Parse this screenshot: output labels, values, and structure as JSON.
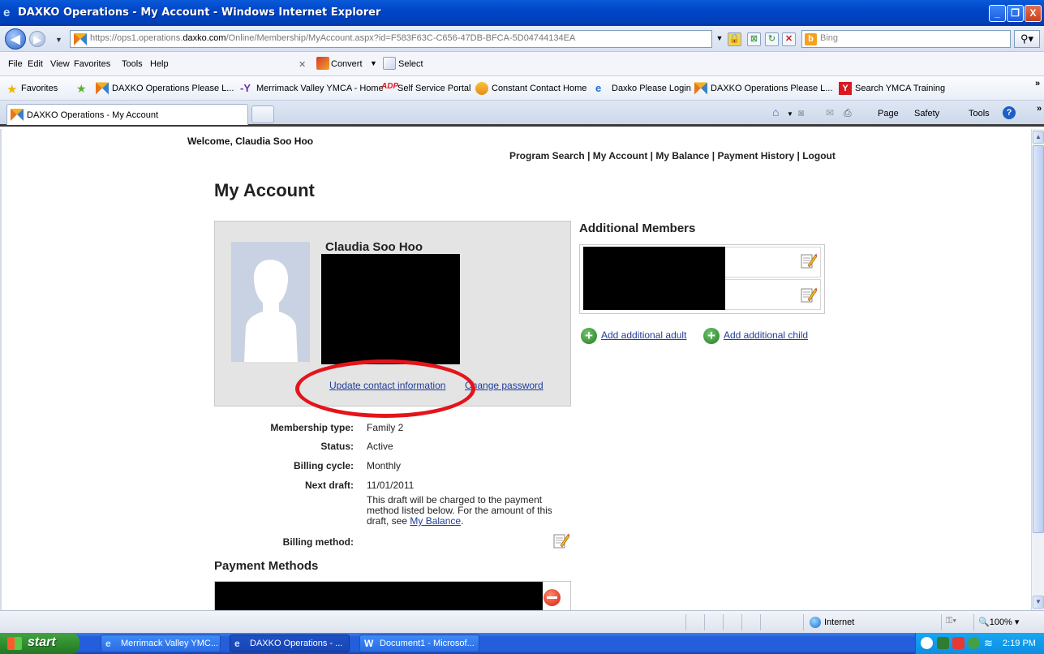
{
  "window": {
    "title": "DAXKO Operations - My Account - Windows Internet Explorer",
    "minimize": "_",
    "restore": "❐",
    "close": "X"
  },
  "address_bar": {
    "url_prefix": "https://ops1.operations.",
    "url_domain": "daxko.com",
    "url_rest": "/Online/Membership/MyAccount.aspx?id=F583F63C-C656-47DB-BFCA-5D04744134EA",
    "search_placeholder": "Bing"
  },
  "menu": {
    "items": [
      "File",
      "Edit",
      "View",
      "Favorites",
      "Tools",
      "Help"
    ],
    "convert_label": "Convert",
    "select_label": "Select"
  },
  "favorites": {
    "label": "Favorites",
    "items": [
      "DAXKO Operations Please L...",
      "Merrimack Valley YMCA - Home",
      "Self Service Portal",
      "Constant Contact Home",
      "Daxko Please Login",
      "DAXKO Operations Please L...",
      "Search YMCA Training"
    ]
  },
  "tabs": {
    "active": "DAXKO Operations - My Account",
    "commands": [
      "Page",
      "Safety",
      "Tools"
    ]
  },
  "page": {
    "welcome": "Welcome, Claudia Soo Hoo",
    "nav": [
      "Program Search",
      "My Account",
      "My Balance",
      "Payment History",
      "Logout"
    ],
    "heading": "My Account",
    "profile": {
      "name": "Claudia Soo Hoo",
      "update_link": "Update contact information",
      "password_link": "Change password"
    },
    "details": {
      "membership_type_label": "Membership type:",
      "membership_type": "Family 2",
      "status_label": "Status:",
      "status": "Active",
      "billing_cycle_label": "Billing cycle:",
      "billing_cycle": "Monthly",
      "next_draft_label": "Next draft:",
      "next_draft": "11/01/2011",
      "draft_note": "This draft will be charged to the payment method listed below. For the amount of this draft, see",
      "draft_note_link": "My Balance",
      "draft_note_end": ".",
      "billing_method_label": "Billing method:"
    },
    "payment_heading": "Payment Methods",
    "additional_heading": "Additional Members",
    "add_adult": "Add additional adult",
    "add_child": "Add additional child"
  },
  "status_bar": {
    "zone": "Internet",
    "zoom": "100%"
  },
  "taskbar": {
    "start": "start",
    "tasks": [
      "Merrimack Valley YMC...",
      "DAXKO Operations - ...",
      "Document1 - Microsof..."
    ],
    "clock": "2:19 PM"
  },
  "colors": {
    "link": "#1f3c9b",
    "annotation_circle": "#e4141b",
    "xp_blue": "#245edb"
  }
}
